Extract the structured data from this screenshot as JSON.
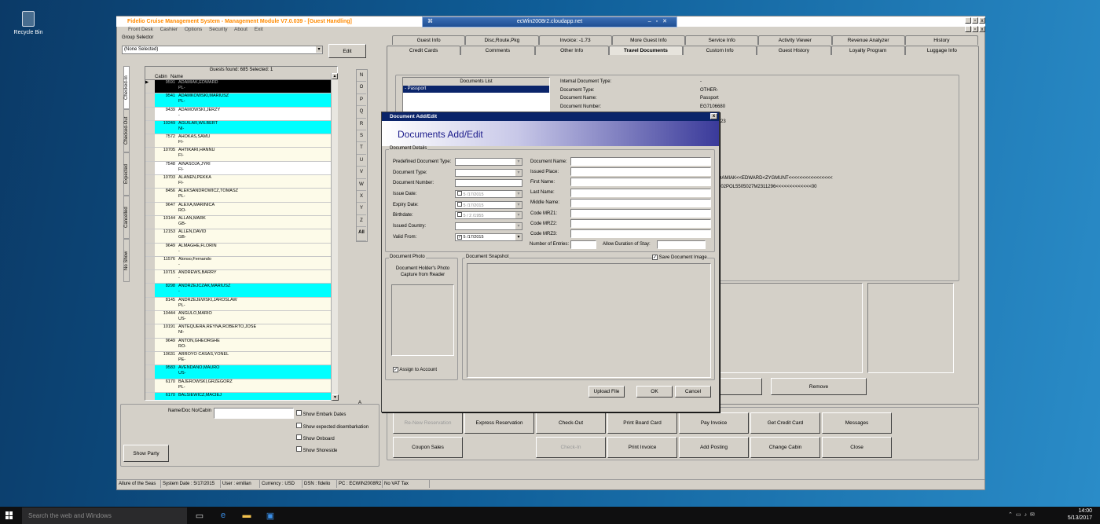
{
  "desktop": {
    "recycle_bin": "Recycle Bin"
  },
  "window": {
    "title": "Fidelio Cruise Management System - Management Module V7.0.039 - [Guest Handling]",
    "rdp_host": "ecWin2008r2.cloudapp.net"
  },
  "menu": [
    "Front Desk",
    "Cashier",
    "Options",
    "Security",
    "About",
    "Exit"
  ],
  "group_selector": {
    "label": "Group Selector",
    "value": "(None Selected)",
    "edit": "Edit"
  },
  "guests": {
    "summary": "Guests found: 685 Selected: 1",
    "col_cabin": "Cabin",
    "col_name": "Name",
    "rows": [
      {
        "cabin": "9591",
        "name": "ADAMIAK,EDWARD",
        "nat": "PL-",
        "style": "selected"
      },
      {
        "cabin": "9541",
        "name": "ADAMKOWSKI,MARIUSZ",
        "nat": "PL-",
        "style": "cyan"
      },
      {
        "cabin": "9439",
        "name": "ADAMOWSKI,JERZY",
        "nat": "-",
        "style": "white"
      },
      {
        "cabin": "10249",
        "name": "AGUILAR,WILBERT",
        "nat": "NI-",
        "style": "cyan"
      },
      {
        "cabin": "7572",
        "name": "AHOKAS,SAMU",
        "nat": "FI-",
        "style": "cream"
      },
      {
        "cabin": "10705",
        "name": "AHTIKARI,HANNU",
        "nat": "FI-",
        "style": "cream"
      },
      {
        "cabin": "7548",
        "name": "AINASOJA,JYRI",
        "nat": "FI-",
        "style": "white"
      },
      {
        "cabin": "10703",
        "name": "ALANEN,PEKKA",
        "nat": "FI-",
        "style": "cream"
      },
      {
        "cabin": "8456",
        "name": "ALEKSANDROWICZ,TOMASZ",
        "nat": "PL-",
        "style": "cream"
      },
      {
        "cabin": "9647",
        "name": "ALEXA,MARINICA",
        "nat": "RO-",
        "style": "cream"
      },
      {
        "cabin": "10144",
        "name": "ALLAN,MARK",
        "nat": "GB-",
        "style": "cream"
      },
      {
        "cabin": "12153",
        "name": "ALLEN,DAVID",
        "nat": "GB-",
        "style": "cream"
      },
      {
        "cabin": "9649",
        "name": "ALMAGHE,FLORIN",
        "nat": "-",
        "style": "cream"
      },
      {
        "cabin": "11576",
        "name": "Alonso,Fernando",
        "nat": "-",
        "style": "cream"
      },
      {
        "cabin": "10715",
        "name": "ANDREWS,BARRY",
        "nat": "-",
        "style": "cream"
      },
      {
        "cabin": "8298",
        "name": "ANDRZEJCZAK,MARIUSZ",
        "nat": "-",
        "style": "cyan"
      },
      {
        "cabin": "8145",
        "name": "ANDRZEJEWSKI,JAROSLAW",
        "nat": "PL-",
        "style": "cream"
      },
      {
        "cabin": "10444",
        "name": "ANGULO,MARIO",
        "nat": "US-",
        "style": "cream"
      },
      {
        "cabin": "10191",
        "name": "ANTEQUERA,REYNA,ROBERTO,JOSE",
        "nat": "NI-",
        "style": "cream"
      },
      {
        "cabin": "9649",
        "name": "ANTON,GHEORGHE",
        "nat": "RO-",
        "style": "cream"
      },
      {
        "cabin": "10631",
        "name": "ARROYO CASAS,YONEL",
        "nat": "PE-",
        "style": "cream"
      },
      {
        "cabin": "9583",
        "name": "AVENDANO,MAURO",
        "nat": "US-",
        "style": "cyan"
      },
      {
        "cabin": "6170",
        "name": "BAJEROWSKI,GRZEGORZ",
        "nat": "PL-",
        "style": "cream"
      },
      {
        "cabin": "6170",
        "name": "BALSIEWICZ,MACIEJ",
        "nat": "",
        "style": "cyan"
      }
    ]
  },
  "side_tabs": [
    "Checked-In",
    "Checked-Out",
    "Expected",
    "Cancelled",
    "No Show"
  ],
  "letters": [
    "N",
    "O",
    "P",
    "Q",
    "R",
    "S",
    "T",
    "U",
    "V",
    "W",
    "X",
    "Y",
    "Z",
    "All"
  ],
  "letter_a": "A",
  "search": {
    "label": "Name/Doc No/Cabin",
    "show_party": "Show Party",
    "options": [
      "Show Embark Dates",
      "Show expected disembarkation",
      "Show Onboard",
      "Show Shoreside"
    ]
  },
  "tabs_top": [
    "Guest Info",
    "Disc,Route,Pkg",
    "Invoice: -1.73",
    "More Guest Info",
    "Service Info",
    "Activity Viewer",
    "Revenue Analyzer",
    "History"
  ],
  "tabs_bottom": [
    "Credit Cards",
    "Comments",
    "Other Info",
    "Travel Documents",
    "Custom Info",
    "Guest History",
    "Loyalty Program",
    "Luggage Info"
  ],
  "documents": {
    "list_header": "Documents List",
    "items": [
      "- Passport"
    ],
    "info": [
      {
        "label": "Internal Document Type:",
        "value": "-"
      },
      {
        "label": "Document Type:",
        "value": "OTHER-"
      },
      {
        "label": "Document Name:",
        "value": "Passport"
      },
      {
        "label": "Document Number:",
        "value": "EG7106680"
      }
    ],
    "partial_value": "23",
    "mrz1": "DAMIAK<<EDWARD<ZYGMUNT<<<<<<<<<<<<<<<<",
    "mrz2": "302POL5505027M2311296<<<<<<<<<<<<<00",
    "remove": "Remove"
  },
  "actions": {
    "row1": [
      "Re-New Reservation",
      "Express Reservation",
      "Check-Out",
      "Print Board Card",
      "Pay Invoice",
      "Get Credit Card",
      "Messages"
    ],
    "row2": [
      "Coupon Sales",
      "",
      "Check-In",
      "Print Invoice",
      "Add Posting",
      "Change Cabin",
      "Close"
    ]
  },
  "dialog": {
    "title": "Document Add/Edit",
    "header": "Documents Add/Edit",
    "details_legend": "Document Details",
    "left_fields": [
      {
        "label": "Predefined Document Type:",
        "type": "dd",
        "value": ""
      },
      {
        "label": "Document Type:",
        "type": "dd",
        "value": ""
      },
      {
        "label": "Document Number:",
        "type": "text",
        "value": ""
      },
      {
        "label": "Issue Date:",
        "type": "date",
        "value": "5 /17/2015",
        "checked": false
      },
      {
        "label": "Expiry Date:",
        "type": "date",
        "value": "5 /17/2015",
        "checked": false
      },
      {
        "label": "Birthdate:",
        "type": "date",
        "value": "5 / 2 /1955",
        "checked": false
      },
      {
        "label": "Issued Country:",
        "type": "dd",
        "value": ""
      },
      {
        "label": "Valid From:",
        "type": "date",
        "value": "5 /17/2015",
        "checked": true
      }
    ],
    "right_fields": [
      "Document Name:",
      "Issued Place:",
      "First Name:",
      "Last Name:",
      "Middle Name:",
      "Code MRZ1:",
      "Code MRZ2:",
      "Code MRZ3:"
    ],
    "entries_label": "Number of Entries:",
    "stay_label": "Allow Duration of Stay:",
    "photo_legend": "Document Photo",
    "photo_caption": "Document Holder's Photo Capture from Reader",
    "assign": "Assign to Account",
    "snapshot_legend": "Document Snapshot",
    "save_image": "Save Document Image",
    "upload": "Upload File",
    "ok": "OK",
    "cancel": "Cancel"
  },
  "status": {
    "items": [
      "Allure of the Seas",
      "System Date : 5/17/2015",
      "User : emilian",
      "Currency : USD",
      "DSN : fidelio",
      "PC : ECWIN2008R2",
      "No VAT Tax"
    ]
  },
  "taskbar": {
    "search": "Search the web and Windows",
    "time": "14:00",
    "date": "5/13/2017"
  }
}
